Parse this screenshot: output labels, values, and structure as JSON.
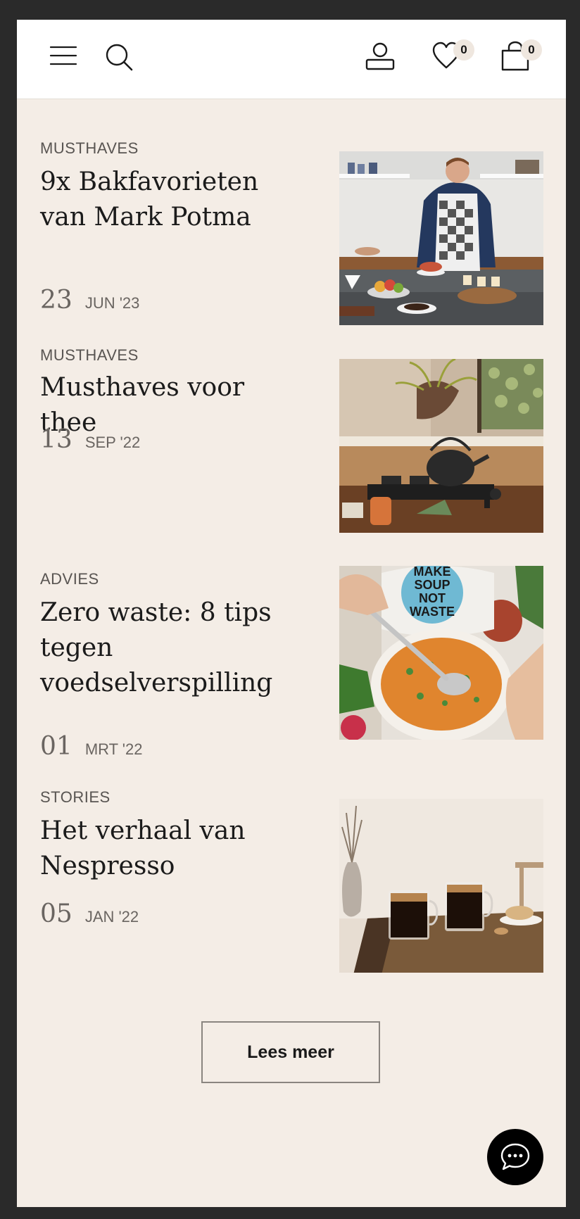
{
  "header": {
    "wishlist_count": "0",
    "cart_count": "0",
    "icons": [
      "menu-icon",
      "search-icon",
      "account-icon",
      "heart-icon",
      "shopping-bag-icon"
    ]
  },
  "articles": [
    {
      "category": "MUSTHAVES",
      "title": "9x Bakfavorieten van Mark Potma",
      "day": "23",
      "month": "JUN '23"
    },
    {
      "category": "MUSTHAVES",
      "title": "Musthaves voor thee",
      "day": "13",
      "month": "SEP '22"
    },
    {
      "category": "ADVIES",
      "title": "Zero waste: 8 tips tegen voedselverspilling",
      "day": "01",
      "month": "MRT '22"
    },
    {
      "category": "STORIES",
      "title": "Het verhaal van Nespresso",
      "day": "05",
      "month": "JAN '22"
    }
  ],
  "thumbnail_texts": {
    "soup_bag": [
      "MAKE",
      "SOUP",
      "NOT",
      "WASTE"
    ]
  },
  "load_more_label": "Lees meer",
  "chat": {
    "icon": "chat-bubble-icon"
  },
  "colors": {
    "page_bg": "#f4ede6",
    "header_bg": "#ffffff",
    "frame_bg": "#2a2a2a",
    "text": "#1b1b1b",
    "muted": "#595552",
    "badge_bg": "#efe7df",
    "chat_bg": "#000000"
  }
}
